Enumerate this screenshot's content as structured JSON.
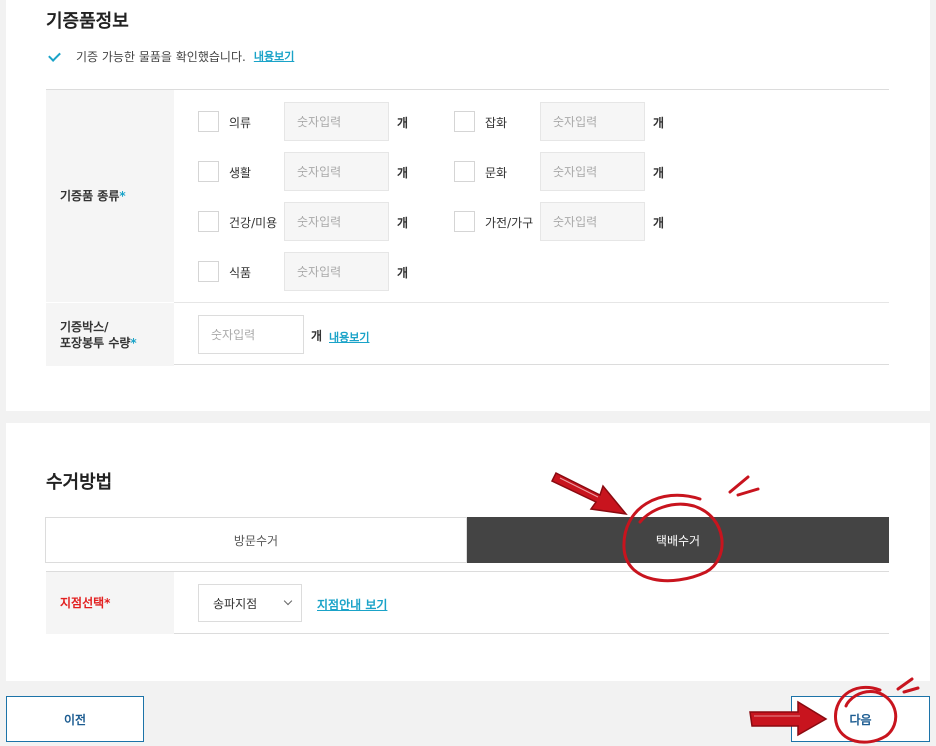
{
  "donation_info": {
    "title": "기증품정보",
    "confirm_text": "기증 가능한 물품을 확인했습니다.",
    "confirm_link": "내용보기",
    "category_label": "기증품 종류",
    "box_label_line1": "기증박스/",
    "box_label_line2": "포장봉투 수량",
    "required_mark": "*",
    "input_placeholder": "숫자입력",
    "unit": "개",
    "box_link": "내용보기",
    "categories": [
      "의류",
      "잡화",
      "생활",
      "문화",
      "건강/미용",
      "가전/가구",
      "식품"
    ]
  },
  "pickup": {
    "title": "수거방법",
    "tabs": [
      "방문수거",
      "택배수거"
    ],
    "active_tab": "택배수거",
    "branch_label": "지점선택",
    "required_mark": "*",
    "branch_value": "송파지점",
    "branch_link": "지점안내 보기"
  },
  "nav": {
    "prev": "이전",
    "next": "다음"
  },
  "colors": {
    "accent": "#1aa3c8",
    "required_red": "#e21f1f",
    "annotation_red": "#c8141e",
    "active_tab": "#444444"
  }
}
